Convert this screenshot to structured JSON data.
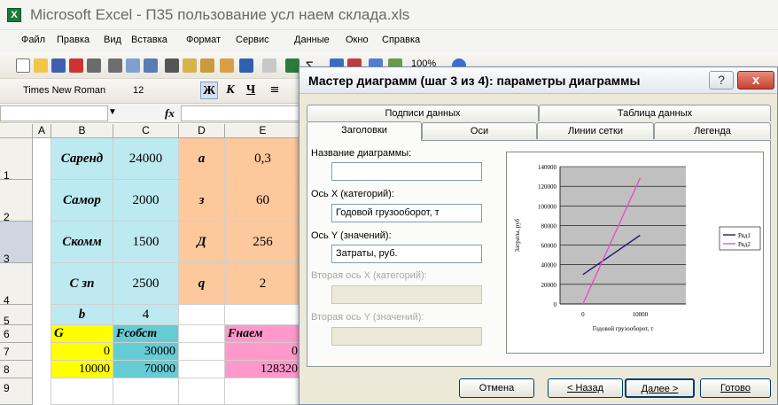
{
  "window": {
    "title": "Microsoft Excel - П35 пользование усл наем склада.xls",
    "app_icon_letter": "X"
  },
  "menu": [
    "Файл",
    "Правка",
    "Вид",
    "Вставка",
    "Формат",
    "Сервис",
    "Данные",
    "Окно",
    "Справка"
  ],
  "toolbar": {
    "zoom": "100%",
    "font_name": "Times New Roman",
    "font_size": "12",
    "bold": "Ж",
    "italic": "К",
    "underline": "Ч",
    "fx": "fx"
  },
  "sheet": {
    "columns": [
      "A",
      "B",
      "C",
      "D",
      "E"
    ],
    "rows": [
      "1",
      "2",
      "3",
      "4",
      "5",
      "6",
      "7",
      "8",
      "9"
    ],
    "cells": {
      "B1": "Саренд",
      "C1": "24000",
      "D1": "a",
      "E1": "0,3",
      "B2": "Самор",
      "C2": "2000",
      "D2": "з",
      "E2": "60",
      "B3": "Скомм",
      "C3": "1500",
      "D3": "Д",
      "E3": "256",
      "B4": "С зп",
      "C4": "2500",
      "D4": "q",
      "E4": "2",
      "B5": "b",
      "C5": "4",
      "B6": "G",
      "C6": "Fсобст",
      "E6": "Fнаем",
      "B7": "0",
      "C7": "30000",
      "E7": "0",
      "B8": "10000",
      "C8": "70000",
      "E8": "128320"
    }
  },
  "dialog": {
    "title": "Мастер диаграмм (шаг 3 из 4): параметры диаграммы",
    "help": "?",
    "close": "x",
    "tabs_top": [
      "Подписи данных",
      "Таблица данных"
    ],
    "tabs_bottom": [
      "Заголовки",
      "Оси",
      "Линии сетки",
      "Легенда"
    ],
    "fields": {
      "chart_title_label": "Название диаграммы:",
      "chart_title_value": "",
      "x_axis_label": "Ось X (категорий):",
      "x_axis_value": "Годовой грузооборот, т",
      "y_axis_label": "Ось Y (значений):",
      "y_axis_value": "Затраты, руб.",
      "x2_axis_label": "Вторая ось X (категорий):",
      "y2_axis_label": "Вторая ось Y (значений):"
    },
    "buttons": {
      "cancel": "Отмена",
      "back": "< Назад",
      "next": "Далее >",
      "finish": "Готово"
    }
  },
  "chart_data": {
    "type": "line",
    "xlabel": "Годовой грузооборот, т",
    "ylabel": "Затраты, руб",
    "x": [
      0,
      10000
    ],
    "xlim": [
      -4000,
      18000
    ],
    "ylim": [
      0,
      140000
    ],
    "yticks": [
      0,
      20000,
      40000,
      60000,
      80000,
      100000,
      120000,
      140000
    ],
    "xticks": [
      0,
      10000
    ],
    "grid": true,
    "legend_position": "right",
    "series": [
      {
        "name": "Ряд1",
        "values": [
          30000,
          70000
        ],
        "color": "#1f1f5e"
      },
      {
        "name": "Ряд2",
        "values": [
          0,
          128320
        ],
        "color": "#e64ec8"
      }
    ]
  },
  "colors": {
    "cyan": "#bde9f1",
    "orange": "#fcc89c",
    "yellow": "#ffff00",
    "teal": "#66ccd4",
    "pink": "#ff99cc"
  }
}
